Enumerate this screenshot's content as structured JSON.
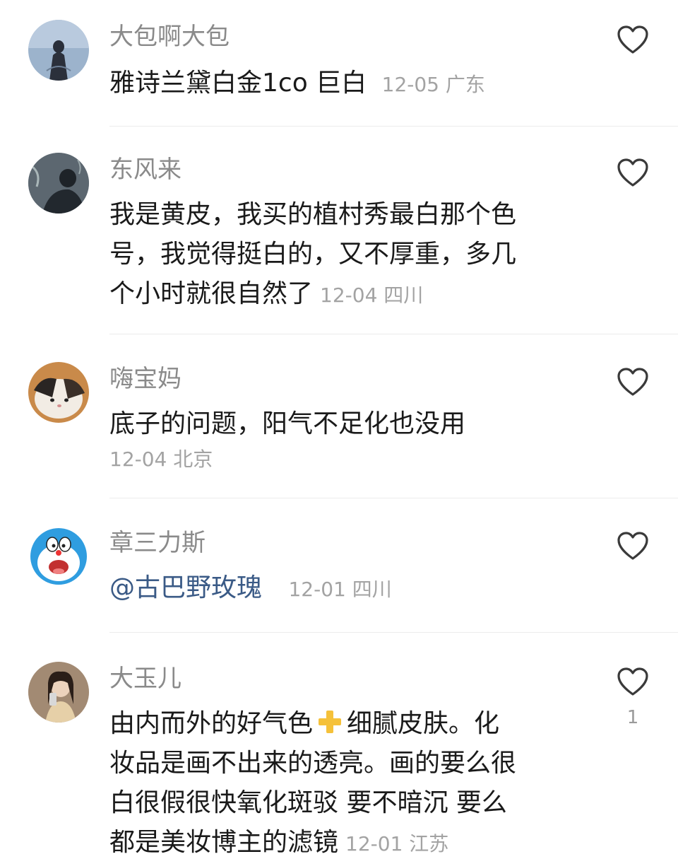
{
  "comments": [
    {
      "username": "大包啊大包",
      "text": "雅诗兰黛白金1co 巨白",
      "date": "12-05",
      "location": "广东",
      "avatar": "woman-silhouette-avatar"
    },
    {
      "username": "东风来",
      "text_lines": [
        "我是黄皮，我买的植村秀最白那个色",
        "号，我觉得挺白的，又不厚重，多几",
        "个小时就很自然了"
      ],
      "date": "12-04",
      "location": "四川",
      "avatar": "dark-figure-avatar"
    },
    {
      "username": "嗨宝妈",
      "text": "底子的问题，阳气不足化也没用",
      "date": "12-04",
      "location": "北京",
      "avatar": "cat-avatar"
    },
    {
      "username": "章三力斯",
      "mention": "@古巴野玫瑰",
      "date": "12-01",
      "location": "四川",
      "avatar": "doraemon-avatar"
    },
    {
      "username": "大玉儿",
      "text_lines": [
        "由内而外的好气色",
        "细腻皮肤。化",
        "妆品是画不出来的透亮。画的要么很",
        "白很假很快氧化斑驳 要不暗沉 要么",
        "都是美妆博主的滤镜"
      ],
      "date": "12-01",
      "location": "江苏",
      "like_count": "1",
      "avatar": "girl-selfie-avatar"
    }
  ],
  "colors": {
    "username": "#8a8a8a",
    "text": "#1a1a1a",
    "meta": "#a3a3a3",
    "mention": "#3a5a86",
    "divider": "#ececec"
  }
}
